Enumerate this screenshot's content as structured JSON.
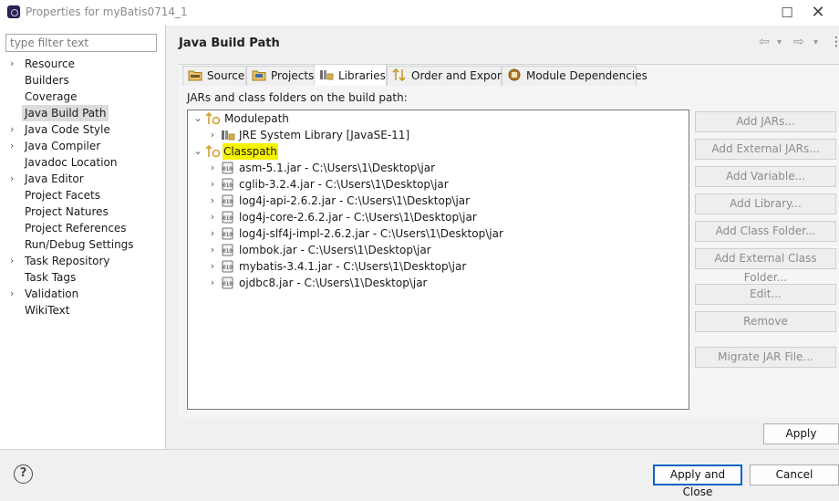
{
  "window": {
    "title": "Properties for myBatis0714_1",
    "maximize_icon": "☐",
    "close_icon": "✕"
  },
  "filter": {
    "placeholder": "type filter text"
  },
  "nav": {
    "items": [
      {
        "label": "Resource",
        "arrow": "›"
      },
      {
        "label": "Builders",
        "arrow": ""
      },
      {
        "label": "Coverage",
        "arrow": ""
      },
      {
        "label": "Java Build Path",
        "arrow": "",
        "selected": true
      },
      {
        "label": "Java Code Style",
        "arrow": "›"
      },
      {
        "label": "Java Compiler",
        "arrow": "›"
      },
      {
        "label": "Javadoc Location",
        "arrow": ""
      },
      {
        "label": "Java Editor",
        "arrow": "›"
      },
      {
        "label": "Project Facets",
        "arrow": ""
      },
      {
        "label": "Project Natures",
        "arrow": ""
      },
      {
        "label": "Project References",
        "arrow": ""
      },
      {
        "label": "Run/Debug Settings",
        "arrow": ""
      },
      {
        "label": "Task Repository",
        "arrow": "›"
      },
      {
        "label": "Task Tags",
        "arrow": ""
      },
      {
        "label": "Validation",
        "arrow": "›"
      },
      {
        "label": "WikiText",
        "arrow": ""
      }
    ]
  },
  "header": {
    "title": "Java Build Path",
    "back_icon": "⇦",
    "forward_icon": "⇨",
    "menu_icon": "⋮",
    "dropdown_icon": "▾"
  },
  "tabs": [
    {
      "label": "Source",
      "icon": "source-folder-icon"
    },
    {
      "label": "Projects",
      "icon": "projects-icon"
    },
    {
      "label": "Libraries",
      "icon": "libraries-icon",
      "active": true
    },
    {
      "label": "Order and Export",
      "icon": "order-export-icon"
    },
    {
      "label": "Module Dependencies",
      "icon": "module-dependencies-icon"
    }
  ],
  "caption": "JARs and class folders on the build path:",
  "tree": {
    "modulepath": {
      "label": "Modulepath",
      "expander": "⌄"
    },
    "jre": {
      "label": "JRE System Library [JavaSE-11]",
      "expander": "›"
    },
    "classpath": {
      "label": "Classpath",
      "expander": "⌄"
    },
    "jars": [
      {
        "label": "asm-5.1.jar - C:\\Users\\1\\Desktop\\jar"
      },
      {
        "label": "cglib-3.2.4.jar - C:\\Users\\1\\Desktop\\jar"
      },
      {
        "label": "log4j-api-2.6.2.jar - C:\\Users\\1\\Desktop\\jar"
      },
      {
        "label": "log4j-core-2.6.2.jar - C:\\Users\\1\\Desktop\\jar"
      },
      {
        "label": "log4j-slf4j-impl-2.6.2.jar - C:\\Users\\1\\Desktop\\jar"
      },
      {
        "label": "lombok.jar - C:\\Users\\1\\Desktop\\jar"
      },
      {
        "label": "mybatis-3.4.1.jar - C:\\Users\\1\\Desktop\\jar"
      },
      {
        "label": "ojdbc8.jar - C:\\Users\\1\\Desktop\\jar"
      }
    ]
  },
  "side_buttons": {
    "add_jars": "Add JARs...",
    "add_external_jars": "Add External JARs...",
    "add_variable": "Add Variable...",
    "add_library": "Add Library...",
    "add_class_folder": "Add Class Folder...",
    "add_external_class_folder": "Add External Class Folder...",
    "edit": "Edit...",
    "remove": "Remove",
    "migrate_jar": "Migrate JAR File..."
  },
  "apply_label": "Apply",
  "apply_close_label": "Apply and Close",
  "cancel_label": "Cancel",
  "help_icon": "?",
  "colors": {
    "highlight": "#f6f200",
    "selection": "#dcdcdc",
    "focus_border": "#0a64c8"
  }
}
